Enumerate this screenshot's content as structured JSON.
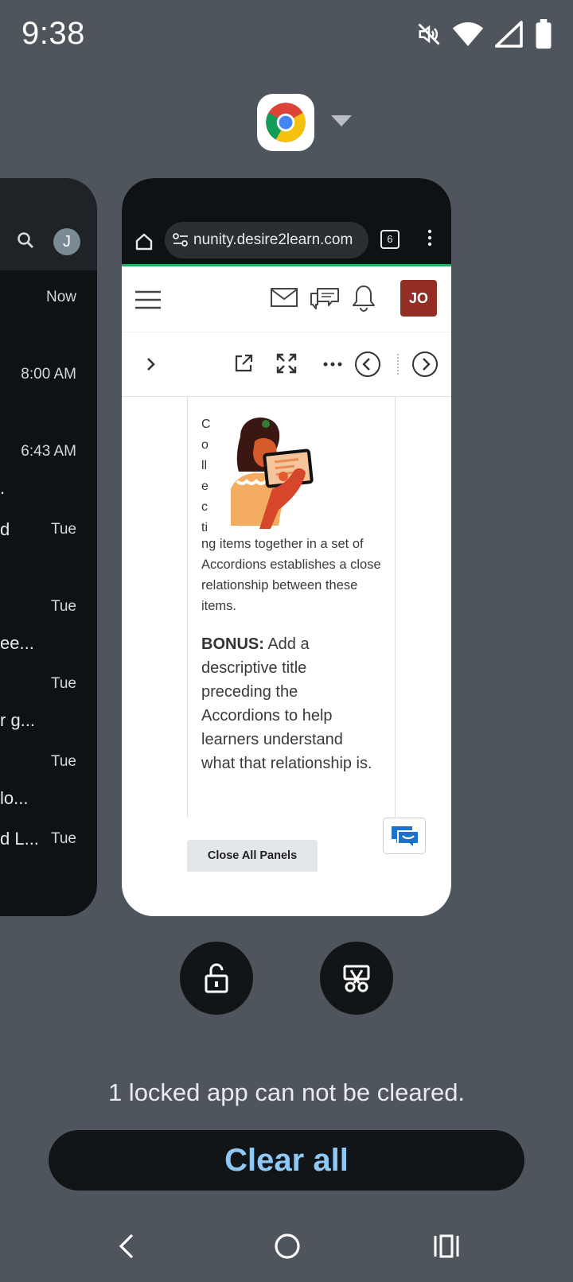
{
  "status_bar": {
    "time": "9:38"
  },
  "app_header": {
    "app_icon": "chrome-icon",
    "dropdown_icon": "caret-down-icon"
  },
  "left_card": {
    "avatar_letter": "J",
    "rows": [
      {
        "time": "Now",
        "snippet": ""
      },
      {
        "time": "8:00 AM",
        "snippet": ""
      },
      {
        "time": "6:43 AM",
        "snippet": "."
      },
      {
        "time": "Tue",
        "snippet": "d",
        "inline": true
      },
      {
        "time": "Tue",
        "snippet": "ee..."
      },
      {
        "time": "Tue",
        "snippet": "r g..."
      },
      {
        "time": "Tue",
        "snippet": "lo..."
      },
      {
        "time": "Tue",
        "snippet": "d L...",
        "inline": true
      }
    ]
  },
  "chrome_card": {
    "url": "nunity.desire2learn.com",
    "tab_count": "6",
    "user_initials": "JO",
    "vertical_letters": [
      "C",
      "o",
      "ll",
      "e",
      "c",
      "ti"
    ],
    "paragraph": "ng items together in a set of Accordions establishes a close relationship between these items.",
    "bonus_label": "BONUS:",
    "bonus_text": " Add a descriptive title preceding the Accordions to help learners understand what that relationship is.",
    "close_panels_label": "Close All Panels"
  },
  "footer": {
    "locked_message": "1 locked app can not be cleared.",
    "clear_all_label": "Clear all"
  },
  "colors": {
    "background": "#4f555c",
    "clear_all_text": "#8ec9f5",
    "user_badge": "#922e24"
  }
}
